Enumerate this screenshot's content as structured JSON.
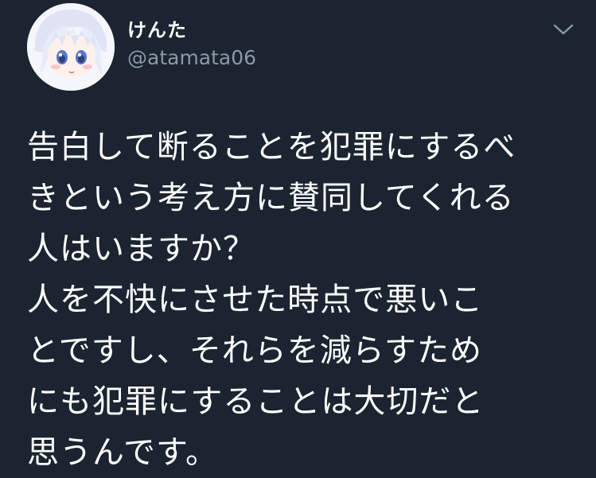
{
  "user": {
    "display_name": "けんた",
    "handle": "@atamata06"
  },
  "tweet": {
    "lines": [
      "告白して断ることを犯罪にするべ",
      "きという考え方に賛同してくれる",
      "人はいますか？",
      "人を不快にさせた時点で悪いこ",
      "とですし、それらを減らすため",
      "にも犯罪にすることは大切だと",
      "思うんです。"
    ]
  },
  "icons": {
    "menu": "chevron-down-icon",
    "avatar": "anime-avatar-image"
  },
  "colors": {
    "background": "#1b2430",
    "text": "#ffffff",
    "secondary": "#8b98a5"
  }
}
